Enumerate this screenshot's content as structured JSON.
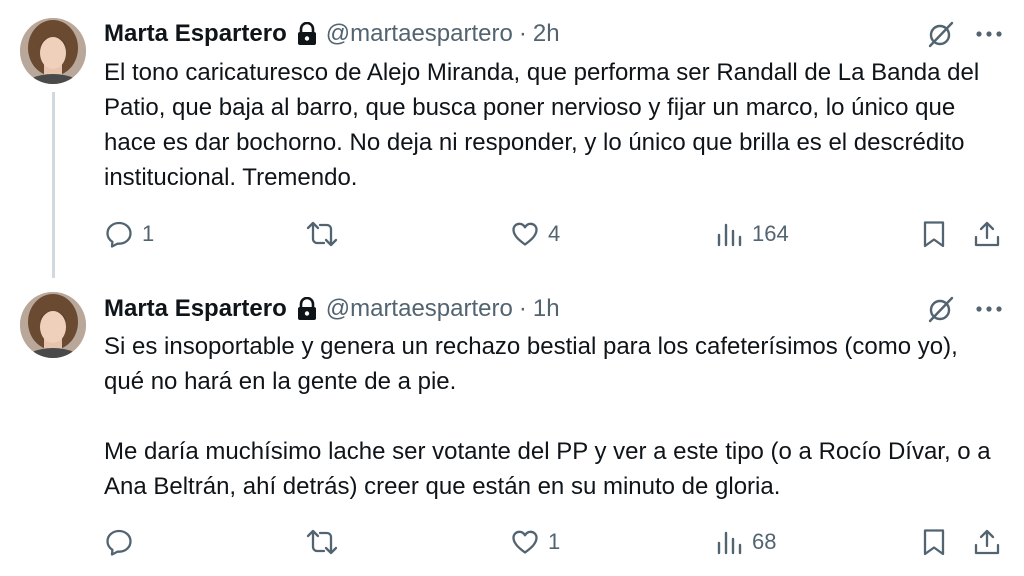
{
  "colors": {
    "text_primary": "#0f1419",
    "text_secondary": "#536471",
    "thread_line": "#cfd9de"
  },
  "tweets": [
    {
      "author": {
        "display_name": "Marta Espartero",
        "handle": "@martaespartero",
        "protected_icon": "lock-icon"
      },
      "separator": "·",
      "time": "2h",
      "paragraphs": [
        "El tono caricaturesco de Alejo Miranda, que performa ser Randall de La Banda del Patio, que baja al barro, que busca poner nervioso y fijar un marco, lo único que hace es dar bochorno. No deja ni responder, y lo único que brilla es el descrédito institucional. Tremendo."
      ],
      "stats": {
        "replies": "1",
        "reposts": "",
        "likes": "4",
        "views": "164"
      }
    },
    {
      "author": {
        "display_name": "Marta Espartero",
        "handle": "@martaespartero",
        "protected_icon": "lock-icon"
      },
      "separator": "·",
      "time": "1h",
      "paragraphs": [
        "Si es insoportable y genera un rechazo bestial para los cafeterísimos (como yo), qué no hará en la gente de a pie.",
        "Me daría muchísimo lache ser votante del PP y ver a este tipo (o a Rocío Dívar, o a Ana Beltrán, ahí detrás) creer que están en su minuto de gloria."
      ],
      "stats": {
        "replies": "",
        "reposts": "",
        "likes": "1",
        "views": "68"
      }
    }
  ]
}
